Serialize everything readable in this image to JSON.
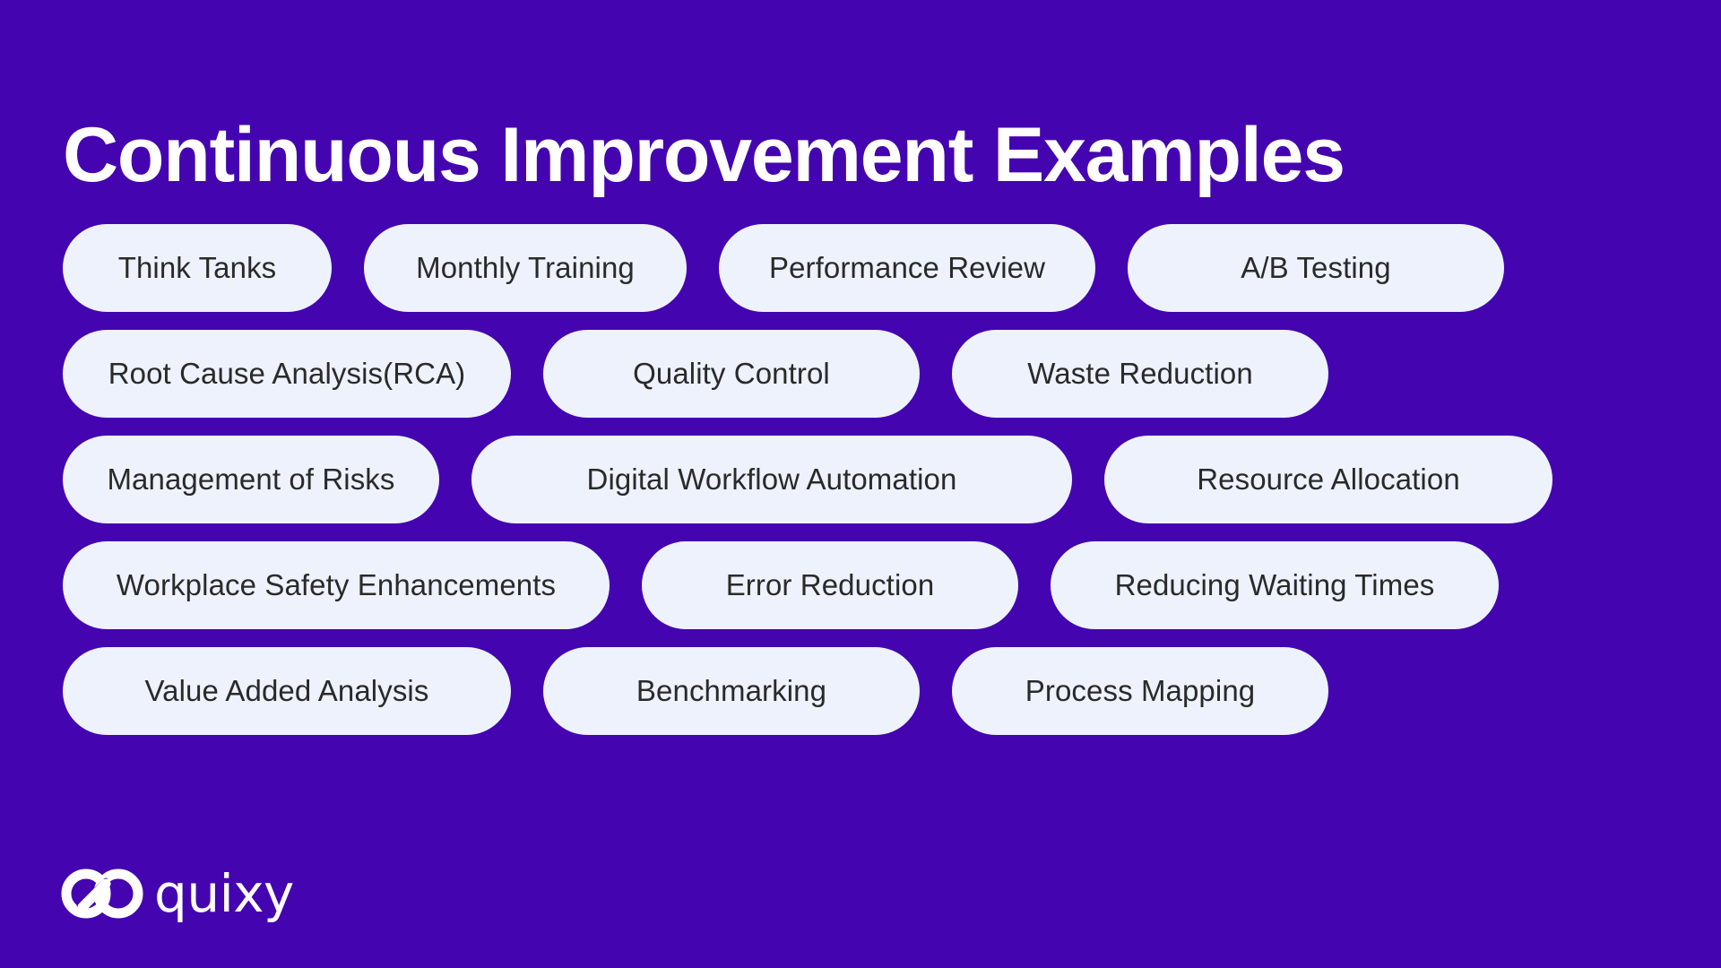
{
  "page": {
    "title": "Continuous Improvement Examples",
    "background_color": "#4405B0",
    "pill_background_color": "#EDF2FD",
    "pill_text_color": "#2A2A2A",
    "title_color": "#FFFFFF"
  },
  "rows": [
    {
      "index": 1,
      "pills": [
        {
          "label": "Think Tanks",
          "size": "w-xs"
        },
        {
          "label": "Monthly Training",
          "size": "w-sm"
        },
        {
          "label": "Performance Review",
          "size": "w-md"
        },
        {
          "label": "A/B Testing",
          "size": "w-md"
        }
      ]
    },
    {
      "index": 2,
      "pills": [
        {
          "label": "Root Cause Analysis(RCA)",
          "size": "w-lg"
        },
        {
          "label": "Quality Control",
          "size": "w-md"
        },
        {
          "label": "Waste Reduction",
          "size": "w-md"
        }
      ]
    },
    {
      "index": 3,
      "pills": [
        {
          "label": "Management of Risks",
          "size": "w-md"
        },
        {
          "label": "Digital Workflow Automation",
          "size": "w-xxl"
        },
        {
          "label": "Resource Allocation",
          "size": "w-lg"
        }
      ]
    },
    {
      "index": 4,
      "pills": [
        {
          "label": "Workplace Safety Enhancements",
          "size": "w-xl"
        },
        {
          "label": "Error Reduction",
          "size": "w-md"
        },
        {
          "label": "Reducing Waiting Times",
          "size": "w-lg"
        }
      ]
    },
    {
      "index": 5,
      "pills": [
        {
          "label": "Value Added Analysis",
          "size": "w-lg"
        },
        {
          "label": "Benchmarking",
          "size": "w-md"
        },
        {
          "label": "Process Mapping",
          "size": "w-md"
        }
      ]
    }
  ],
  "logo": {
    "wordmark": "quixy",
    "mark_icon": "interlocking-loops-icon",
    "color": "#FFFFFF"
  }
}
